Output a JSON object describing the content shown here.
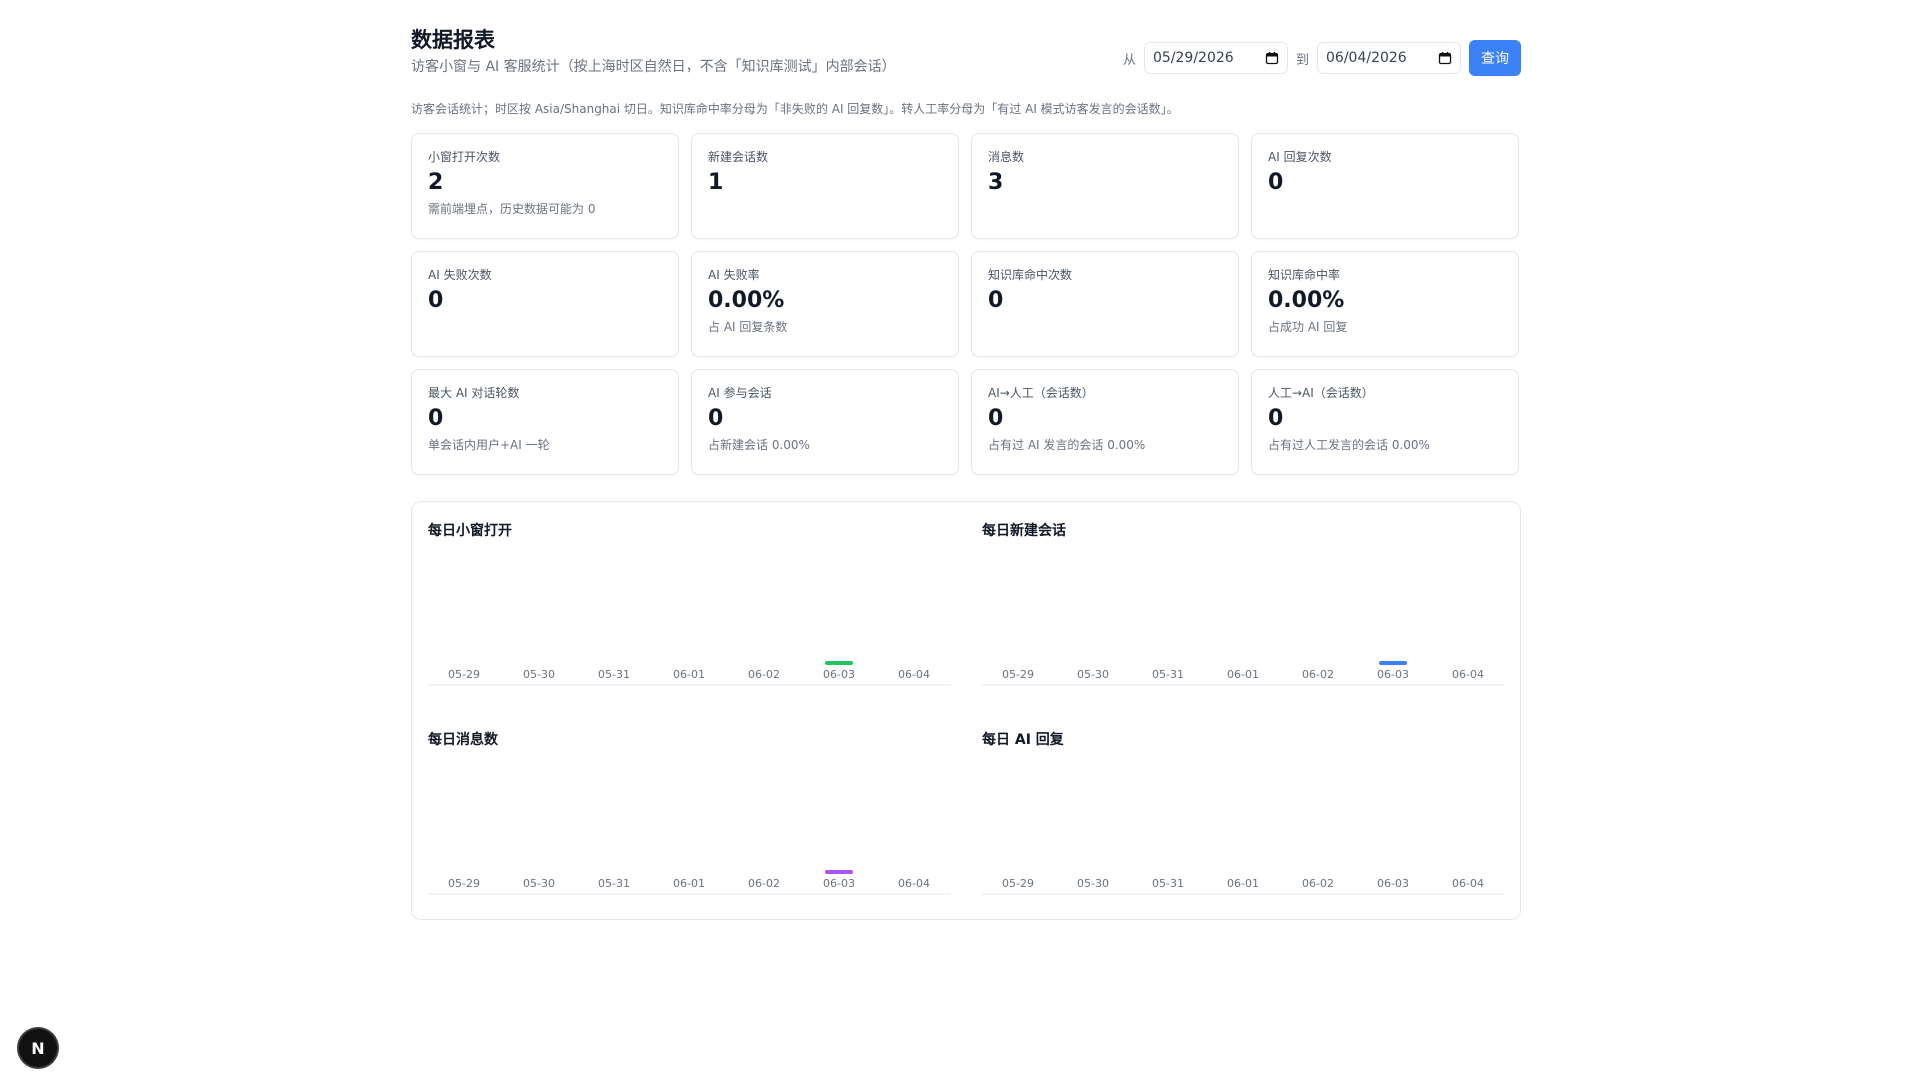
{
  "header": {
    "title": "数据报表",
    "subtitle": "访客小窗与 AI 客服统计（按上海时区自然日，不含「知识库测试」内部会话）",
    "from_label": "从",
    "to_label": "到",
    "from_date": "05/29/2026",
    "to_date": "06/04/2026",
    "query_label": "查询"
  },
  "note": "访客会话统计；时区按 Asia/Shanghai 切日。知识库命中率分母为「非失败的 AI 回复数」。转人工率分母为「有过 AI 模式访客发言的会话数」。",
  "cards": [
    {
      "label": "小窗打开次数",
      "value": "2",
      "note": "需前端埋点，历史数据可能为 0"
    },
    {
      "label": "新建会话数",
      "value": "1",
      "note": ""
    },
    {
      "label": "消息数",
      "value": "3",
      "note": ""
    },
    {
      "label": "AI 回复次数",
      "value": "0",
      "note": ""
    },
    {
      "label": "AI 失败次数",
      "value": "0",
      "note": ""
    },
    {
      "label": "AI 失败率",
      "value": "0.00%",
      "note": "占 AI 回复条数"
    },
    {
      "label": "知识库命中次数",
      "value": "0",
      "note": ""
    },
    {
      "label": "知识库命中率",
      "value": "0.00%",
      "note": "占成功 AI 回复"
    },
    {
      "label": "最大 AI 对话轮数",
      "value": "0",
      "note": "单会话内用户+AI 一轮"
    },
    {
      "label": "AI 参与会话",
      "value": "0",
      "note": "占新建会话 0.00%"
    },
    {
      "label": "AI→人工（会话数）",
      "value": "0",
      "note": "占有过 AI 发言的会话 0.00%"
    },
    {
      "label": "人工→AI（会话数）",
      "value": "0",
      "note": "占有过人工发言的会话 0.00%"
    }
  ],
  "chart_data": [
    {
      "type": "bar",
      "title": "每日小窗打开",
      "categories": [
        "05-29",
        "05-30",
        "05-31",
        "06-01",
        "06-02",
        "06-03",
        "06-04"
      ],
      "values": [
        0,
        0,
        0,
        0,
        0,
        2,
        0
      ],
      "color": "#22c55e"
    },
    {
      "type": "bar",
      "title": "每日新建会话",
      "categories": [
        "05-29",
        "05-30",
        "05-31",
        "06-01",
        "06-02",
        "06-03",
        "06-04"
      ],
      "values": [
        0,
        0,
        0,
        0,
        0,
        1,
        0
      ],
      "color": "#3b82f6"
    },
    {
      "type": "bar",
      "title": "每日消息数",
      "categories": [
        "05-29",
        "05-30",
        "05-31",
        "06-01",
        "06-02",
        "06-03",
        "06-04"
      ],
      "values": [
        0,
        0,
        0,
        0,
        0,
        3,
        0
      ],
      "color": "#a855f7"
    },
    {
      "type": "bar",
      "title": "每日 AI 回复",
      "categories": [
        "05-29",
        "05-30",
        "05-31",
        "06-01",
        "06-02",
        "06-03",
        "06-04"
      ],
      "values": [
        0,
        0,
        0,
        0,
        0,
        0,
        0
      ],
      "color": "#f59e0b"
    }
  ],
  "badge": {
    "icon": "nextjs-icon",
    "letter": "N"
  }
}
